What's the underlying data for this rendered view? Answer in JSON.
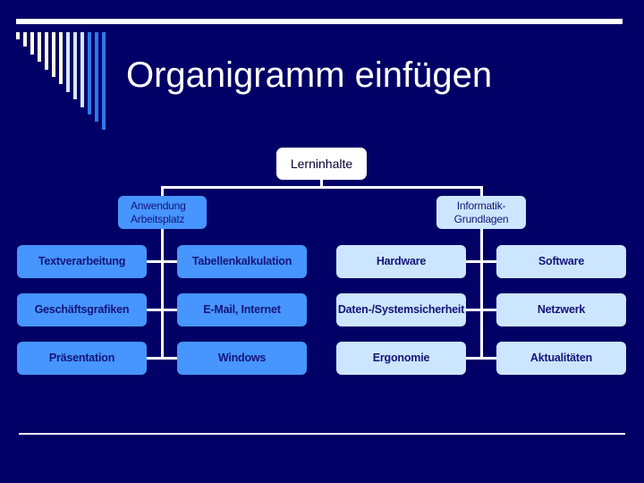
{
  "slide": {
    "title": "Organigramm einfügen",
    "colors": {
      "background": "#000066",
      "rule": "#ffffff",
      "branch_blue": "#4795ff",
      "branch_pale": "#cce6ff",
      "node_text": "#141478",
      "deco_bars": [
        "#ffffe0",
        "#ffffe0",
        "#ffffe0",
        "#ffffe0",
        "#ffffe0",
        "#ffffe0",
        "#ffffe0",
        "#d6e6ff",
        "#d6e6ff",
        "#d6e6ff",
        "#2f78ec",
        "#2f78ec",
        "#2f78ec"
      ]
    }
  },
  "orgchart": {
    "root": "Lerninhalte",
    "branches": [
      {
        "label_lines": [
          "Anwendung",
          "Arbeitsplatz"
        ],
        "style": "blue",
        "children": [
          {
            "column": "left",
            "items": [
              "Textverarbeitung",
              "Geschäftsgrafiken",
              "Präsentation"
            ]
          },
          {
            "column": "right",
            "items": [
              "Tabellenkalkulation",
              "E-Mail, Internet",
              "Windows"
            ]
          }
        ]
      },
      {
        "label_lines": [
          "Informatik-",
          "Grundlagen"
        ],
        "style": "pale",
        "children": [
          {
            "column": "left",
            "items": [
              "Hardware",
              "Daten-/Systemsicherheit",
              "Ergonomie"
            ]
          },
          {
            "column": "right",
            "items": [
              "Software",
              "Netzwerk",
              "Aktualitäten"
            ]
          }
        ]
      }
    ]
  }
}
